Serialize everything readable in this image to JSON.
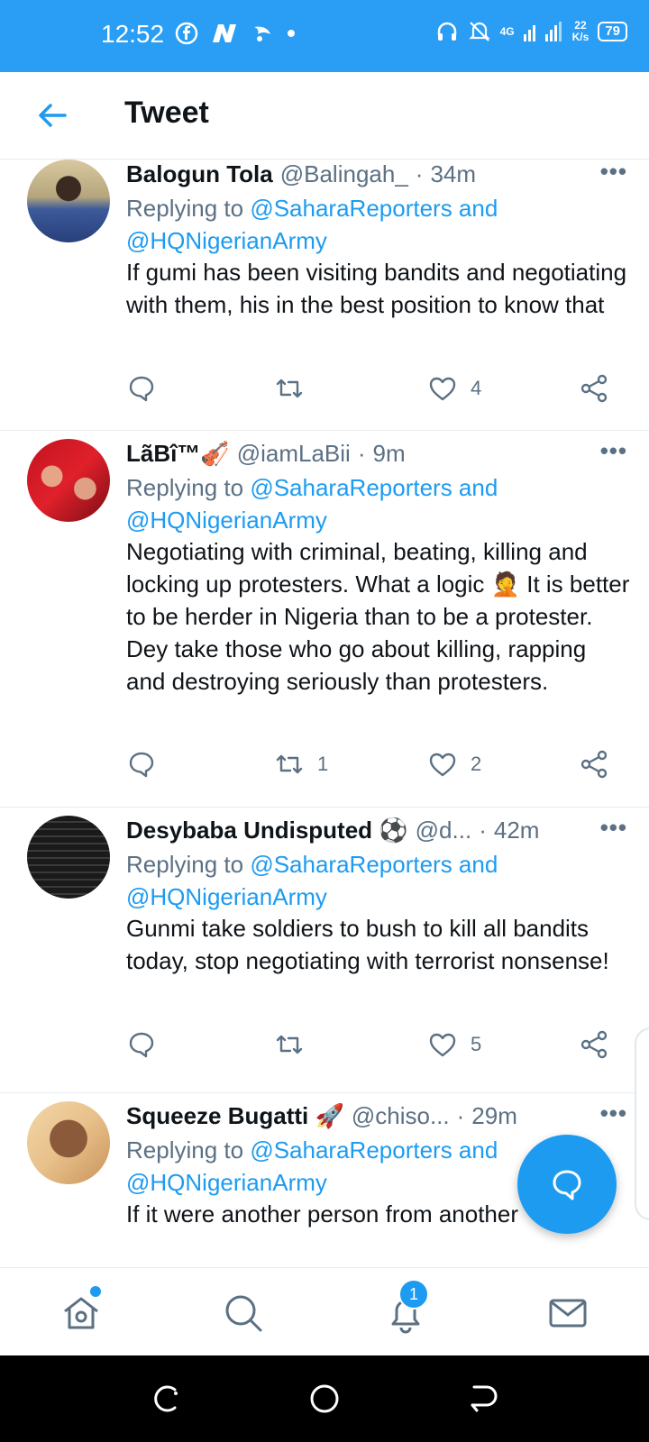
{
  "status_bar": {
    "time": "12:52",
    "network": "4G",
    "speed_value": "22",
    "speed_unit": "K/s",
    "battery": "79"
  },
  "header": {
    "title": "Tweet"
  },
  "tweets": [
    {
      "name": "Balogun Tola",
      "handle": "@Balingah_",
      "time": "34m",
      "replying_prefix": "Replying to ",
      "replying_to": "@SaharaReporters and @HQNigerianArmy",
      "text": "If gumi has been visiting bandits and negotiating with  them, his in the best position to know that",
      "retweets": "",
      "likes": "4"
    },
    {
      "name": "LãBî™🎻",
      "handle": "@iamLaBii",
      "time": "9m",
      "replying_prefix": "Replying to ",
      "replying_to": "@SaharaReporters and @HQNigerianArmy",
      "text": "Negotiating with criminal, beating, killing and locking up protesters. What a logic 🤦 It is better to be herder in Nigeria than to be a protester. Dey take those who go about killing, rapping and destroying seriously than protesters.",
      "retweets": "1",
      "likes": "2"
    },
    {
      "name": "Desybaba Undisputed ⚽",
      "handle": "@d...",
      "time": "42m",
      "replying_prefix": "Replying to ",
      "replying_to": "@SaharaReporters and @HQNigerianArmy",
      "text": "Gunmi take soldiers to bush to kill all bandits today, stop negotiating with terrorist nonsense!",
      "retweets": "",
      "likes": "5"
    },
    {
      "name": "Squeeze Bugatti 🚀",
      "handle": "@chiso...",
      "time": "29m",
      "replying_prefix": "Replying to ",
      "replying_to": "@SaharaReporters and @HQNigerianArmy",
      "text": "If it were another person from another",
      "retweets": "",
      "likes": ""
    }
  ],
  "more_label": "•••",
  "bottom_nav": {
    "items": [
      "home-icon",
      "search-icon",
      "notifications-icon",
      "messages-icon"
    ],
    "notification_count": "1"
  },
  "colors": {
    "accent": "#1d9bf0",
    "status_bar": "#2a9df4",
    "muted": "#5b7083"
  }
}
